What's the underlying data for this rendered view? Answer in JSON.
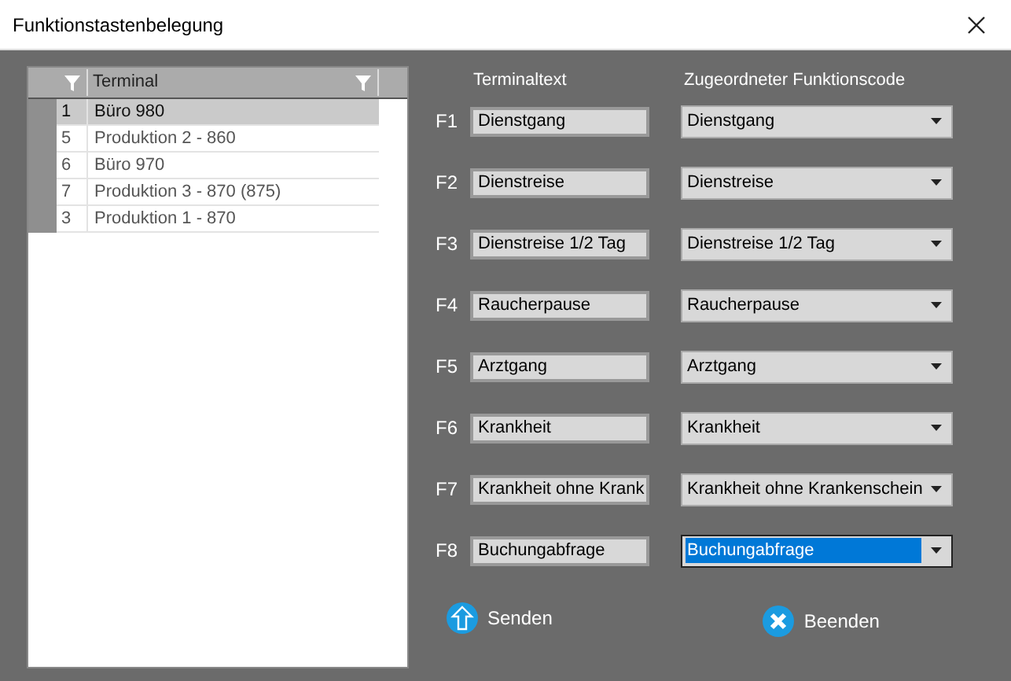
{
  "window": {
    "title": "Funktionstastenbelegung"
  },
  "grid": {
    "columns": [
      "Terminal"
    ],
    "rows": [
      {
        "number": "1",
        "name": "Büro 980",
        "selected": true
      },
      {
        "number": "5",
        "name": "Produktion 2 - 860",
        "selected": false
      },
      {
        "number": "6",
        "name": "Büro 970",
        "selected": false
      },
      {
        "number": "7",
        "name": "Produktion 3 - 870 (875)",
        "selected": false
      },
      {
        "number": "3",
        "name": "Produktion 1 - 870",
        "selected": false
      }
    ]
  },
  "headers": {
    "terminal_text": "Terminaltext",
    "function_code": "Zugeordneter Funktionscode"
  },
  "keys": [
    {
      "key": "F1",
      "text": "Dienstgang",
      "code": "Dienstgang",
      "focused": false
    },
    {
      "key": "F2",
      "text": "Dienstreise",
      "code": "Dienstreise",
      "focused": false
    },
    {
      "key": "F3",
      "text": "Dienstreise 1/2 Tag",
      "code": "Dienstreise 1/2 Tag",
      "focused": false
    },
    {
      "key": "F4",
      "text": "Raucherpause",
      "code": "Raucherpause",
      "focused": false
    },
    {
      "key": "F5",
      "text": "Arztgang",
      "code": "Arztgang",
      "focused": false
    },
    {
      "key": "F6",
      "text": "Krankheit",
      "code": "Krankheit",
      "focused": false
    },
    {
      "key": "F7",
      "text": "Krankheit ohne Krank",
      "code": "Krankheit ohne Krankenschein",
      "focused": false
    },
    {
      "key": "F8",
      "text": "Buchungabfrage",
      "code": "Buchungabfrage",
      "focused": true
    }
  ],
  "buttons": {
    "send": "Senden",
    "quit": "Beenden"
  }
}
